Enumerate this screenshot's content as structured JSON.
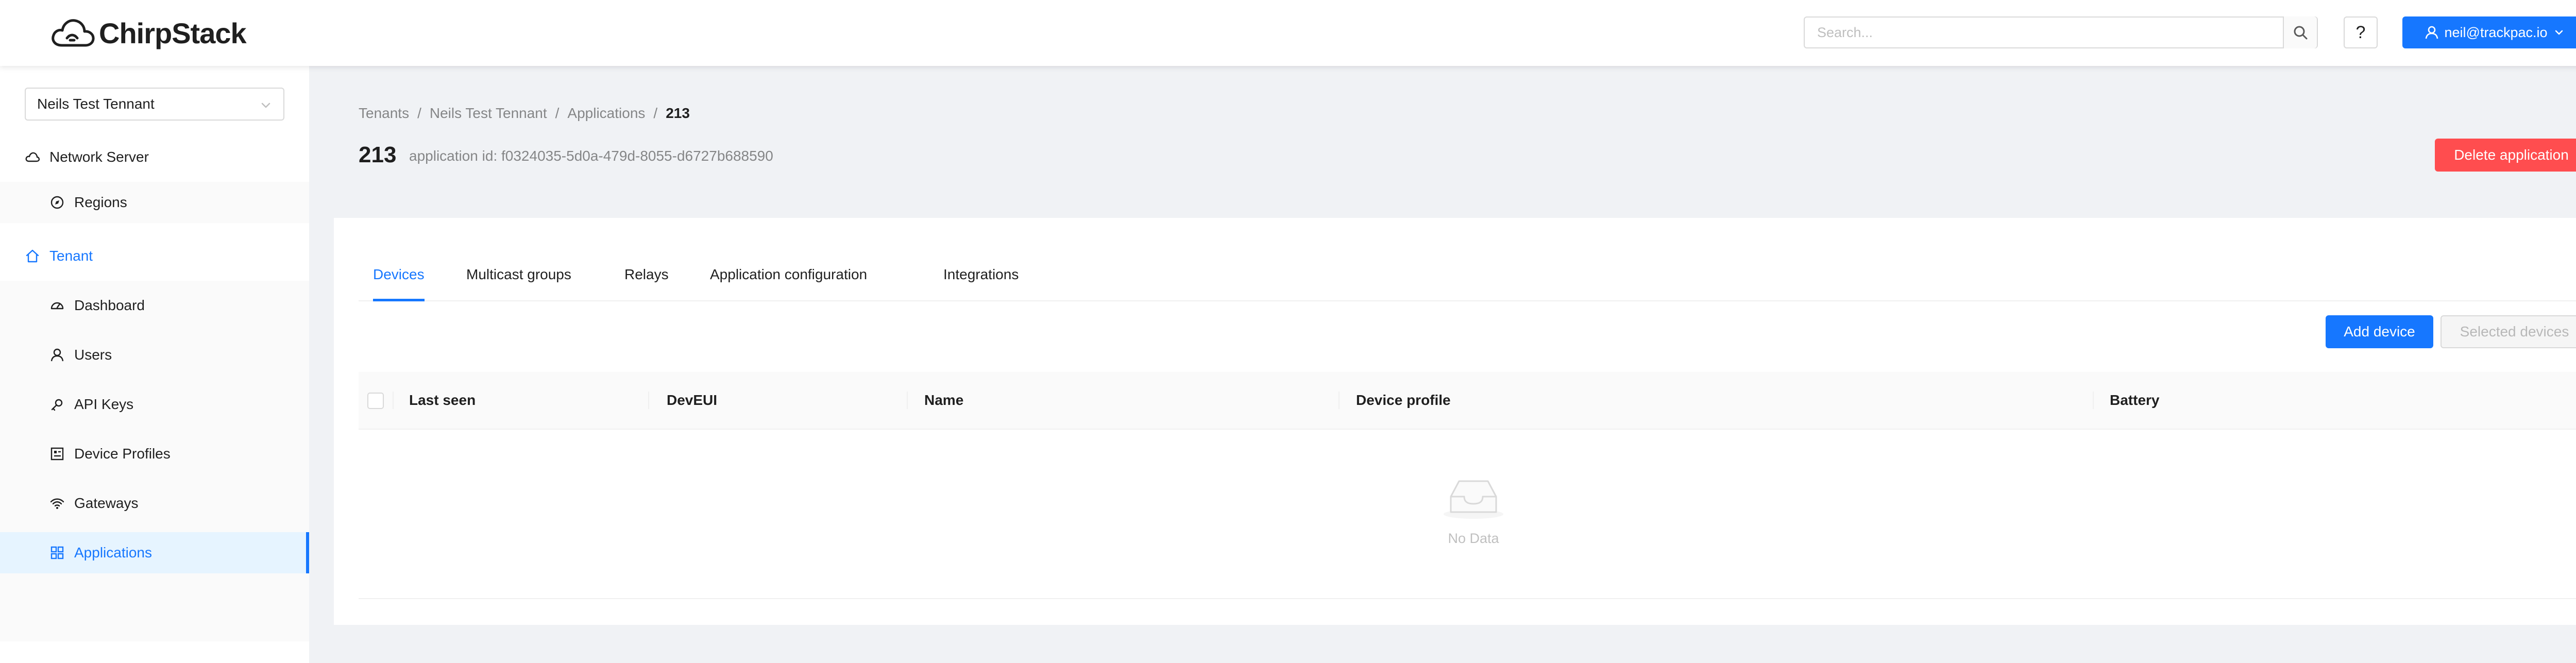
{
  "header": {
    "logo_text": "ChirpStack",
    "search_placeholder": "Search...",
    "help_label": "?",
    "user_label": "neil@trackpac.io"
  },
  "sidebar": {
    "tenant_select": "Neils Test Tennant",
    "network_server": {
      "label": "Network Server",
      "items": [
        {
          "label": "Regions"
        }
      ]
    },
    "tenant": {
      "label": "Tenant",
      "items": [
        {
          "label": "Dashboard"
        },
        {
          "label": "Users"
        },
        {
          "label": "API Keys"
        },
        {
          "label": "Device Profiles"
        },
        {
          "label": "Gateways"
        },
        {
          "label": "Applications",
          "active": true
        }
      ]
    }
  },
  "main": {
    "breadcrumb": [
      "Tenants",
      "Neils Test Tennant",
      "Applications",
      "213"
    ],
    "breadcrumb_sep": "/",
    "title": "213",
    "subtitle": "application id: f0324035-5d0a-479d-8055-d6727b688590",
    "delete_label": "Delete application",
    "tabs": [
      {
        "label": "Devices",
        "active": true
      },
      {
        "label": "Multicast groups"
      },
      {
        "label": "Relays"
      },
      {
        "label": "Application configuration"
      },
      {
        "label": "Integrations"
      }
    ],
    "add_device_label": "Add device",
    "selected_devices_label": "Selected devices",
    "table": {
      "columns": [
        "Last seen",
        "DevEUI",
        "Name",
        "Device profile",
        "Battery"
      ],
      "empty_text": "No Data"
    }
  },
  "colors": {
    "primary": "#1677ff",
    "danger": "#ff4d4f",
    "background": "#f0f2f5"
  }
}
